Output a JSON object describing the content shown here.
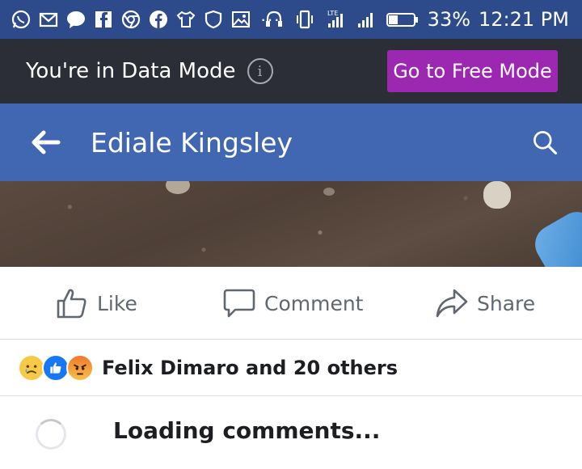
{
  "status_bar": {
    "left_icons": [
      "whatsapp-icon",
      "gmail-icon",
      "messenger-icon",
      "facebook-lite-icon",
      "chrome-icon",
      "facebook-icon",
      "shirt-icon",
      "shield-icon",
      "gallery-icon"
    ],
    "more_indicator": "···",
    "right_icons": [
      "headphones-icon",
      "vibrate-icon",
      "lte-signal-icon",
      "signal-icon",
      "battery-icon"
    ],
    "battery": "33%",
    "time": "12:21 PM",
    "lte_label": "LTE"
  },
  "data_mode": {
    "message": "You're in Data Mode",
    "info_symbol": "i",
    "button_label": "Go to Free Mode",
    "button_color": "#9c27b0"
  },
  "header": {
    "title": "Ediale Kingsley",
    "bar_color": "#4267b2"
  },
  "actions": {
    "like_label": "Like",
    "comment_label": "Comment",
    "share_label": "Share"
  },
  "reactions": {
    "types": [
      "sad",
      "like",
      "angry"
    ],
    "summary": "Felix Dimaro and 20 others"
  },
  "comments": {
    "loading_text": "Loading comments..."
  }
}
